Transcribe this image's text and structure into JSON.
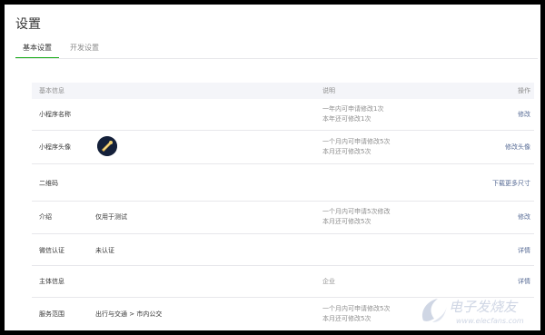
{
  "page": {
    "title": "设置"
  },
  "tabs": [
    {
      "label": "基本设置",
      "active": true
    },
    {
      "label": "开发设置",
      "active": false
    }
  ],
  "table": {
    "headers": {
      "info": "基本信息",
      "desc": "说明",
      "action": "操作"
    },
    "rows": [
      {
        "label": "小程序名称",
        "value": "",
        "desc": [
          "一年内可申请修改1次",
          "本年还可修改1次"
        ],
        "action": "修改"
      },
      {
        "label": "小程序头像",
        "value": "",
        "desc": [
          "一个月内可申请修改5次",
          "本月还可修改5次"
        ],
        "action": "修改头像"
      },
      {
        "label": "二维码",
        "value": "",
        "desc": [],
        "action": "下载更多尺寸"
      },
      {
        "label": "介绍",
        "value": "仅用于测试",
        "desc": [
          "一个月内可申请5次修改",
          "本月还可修改5次"
        ],
        "action": "修改"
      },
      {
        "label": "微信认证",
        "value": "未认证",
        "desc": [],
        "action": "详情"
      },
      {
        "label": "主体信息",
        "value": "",
        "desc": [
          "企业"
        ],
        "action": "详情"
      },
      {
        "label": "服务范围",
        "value": "出行与交通 > 市内公交",
        "desc": [
          "一个月内可申请修改5次",
          "本月还可修改5次"
        ],
        "action": ""
      }
    ]
  },
  "watermark": {
    "text": "电子发烧友",
    "url": "www.elecfans.com"
  },
  "colors": {
    "accent": "#1aad19",
    "link": "#576b95"
  }
}
